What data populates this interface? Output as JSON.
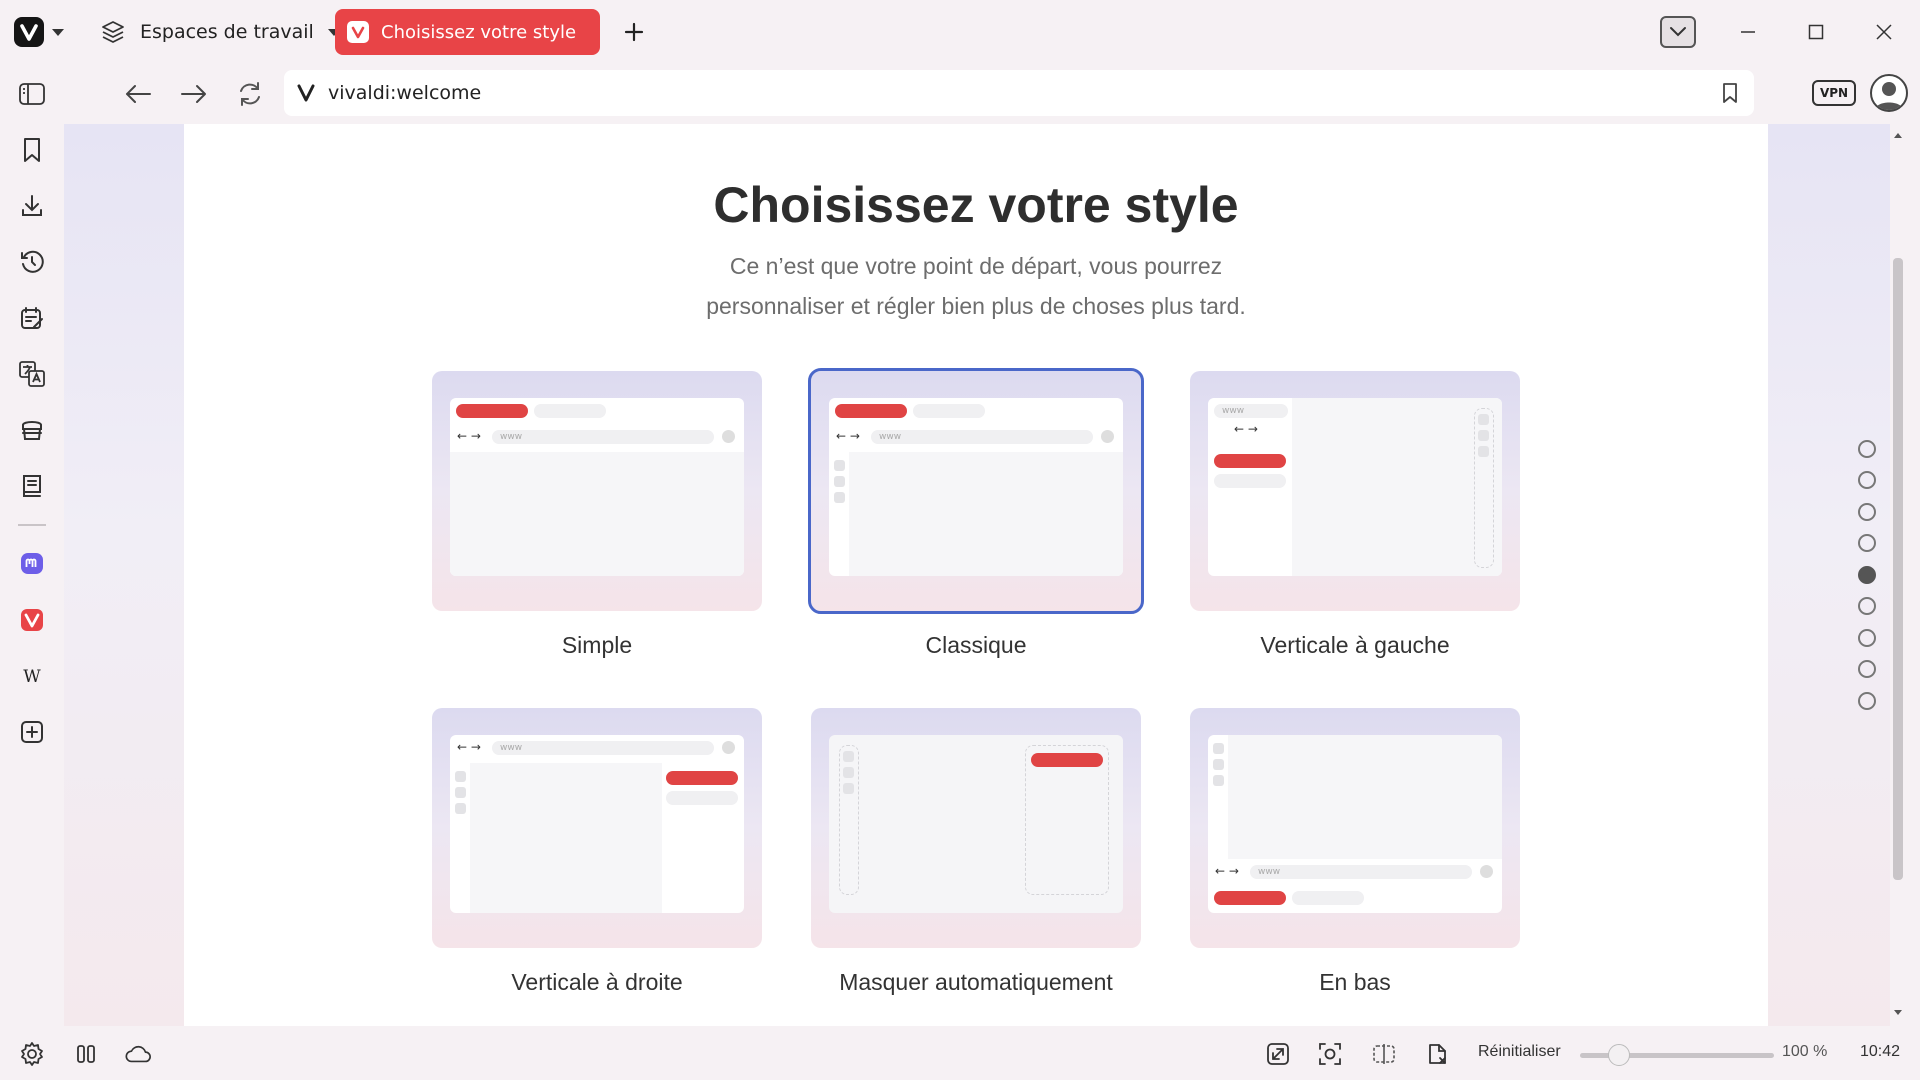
{
  "browser": {
    "workspaces_label": "Espaces de travail",
    "active_tab_title": "Choisissez votre style",
    "url": "vivaldi:welcome",
    "vpn_label": "VPN",
    "accent_color": "#e84447"
  },
  "page": {
    "title": "Choisissez votre style",
    "subtitle_line1": "Ce n’est que votre point de départ, vous pourrez",
    "subtitle_line2": "personnaliser et régler bien plus de choses plus tard.",
    "url_placeholder": "www",
    "styles": [
      {
        "label": "Simple",
        "selected": false
      },
      {
        "label": "Classique",
        "selected": true
      },
      {
        "label": "Verticale à gauche",
        "selected": false
      },
      {
        "label": "Verticale à droite",
        "selected": false
      },
      {
        "label": "Masquer automatiquement",
        "selected": false
      },
      {
        "label": "En bas",
        "selected": false
      }
    ]
  },
  "progress_dots": {
    "total": 9,
    "current": 5
  },
  "statusbar": {
    "reset_label": "Réinitialiser",
    "zoom": "100 %",
    "clock": "10:42"
  },
  "panel_icons": [
    "panel-toggle-icon",
    "bookmarks-icon",
    "downloads-icon",
    "history-icon",
    "notes-icon",
    "translate-icon",
    "reading-list-icon",
    "reader-icon",
    "mastodon-icon",
    "vivaldi-icon",
    "wikipedia-icon",
    "add-web-panel-icon"
  ]
}
